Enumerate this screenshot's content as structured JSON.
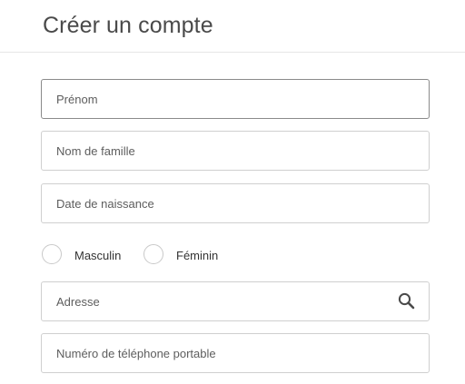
{
  "header": {
    "title": "Créer un compte"
  },
  "form": {
    "first_name": {
      "placeholder": "Prénom",
      "value": ""
    },
    "last_name": {
      "placeholder": "Nom de famille",
      "value": ""
    },
    "birth_date": {
      "placeholder": "Date de naissance",
      "value": ""
    },
    "gender": {
      "options": [
        {
          "label": "Masculin",
          "selected": false
        },
        {
          "label": "Féminin",
          "selected": false
        }
      ]
    },
    "address": {
      "placeholder": "Adresse",
      "value": "",
      "icon": "search-icon"
    },
    "mobile_phone": {
      "placeholder": "Numéro de téléphone portable",
      "value": ""
    }
  },
  "colors": {
    "border": "#cfcfcf",
    "border_focused": "#8a8a8a",
    "text": "#333333",
    "placeholder": "#5d5d5d",
    "title": "#4a4a4a"
  }
}
